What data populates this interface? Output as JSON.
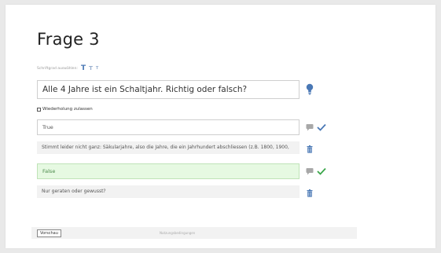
{
  "page": {
    "title": "Frage 3"
  },
  "font_size": {
    "label": "Schriftgrad auswählen:",
    "options": [
      "T",
      "T",
      "T"
    ]
  },
  "question": {
    "text": "Alle 4 Jahre ist ein Schaltjahr. Richtig oder falsch?"
  },
  "repeat_option": {
    "label": "Wiederholung zulassen",
    "checked": false
  },
  "answers": [
    {
      "text": "True",
      "feedback": "Stimmt leider nicht ganz: Säkularjahre, also die Jahre, die ein Jahrhundert abschliessen (z.B. 1800, 1900,",
      "correct": false
    },
    {
      "text": "False",
      "feedback": "Nur geraten oder gewusst?",
      "correct": true
    }
  ],
  "footer": {
    "preview_label": "Vorschau",
    "terms_label": "Nutzungsbedingungen"
  },
  "colors": {
    "accent": "#4a78b5",
    "correct_green": "#3aa64a",
    "correct_bg": "#e6f9e2"
  }
}
